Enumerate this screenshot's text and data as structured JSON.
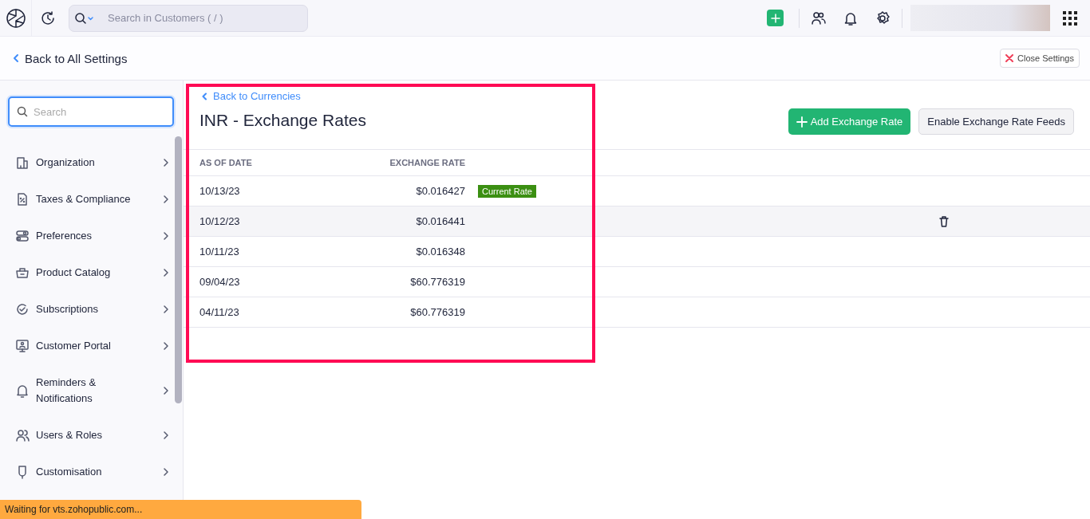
{
  "topbar": {
    "search": {
      "placeholder": "Search in Customers ( / )"
    }
  },
  "header": {
    "back_link": "Back to All Settings",
    "close_button": "Close Settings"
  },
  "sidebar": {
    "search": {
      "placeholder": "Search"
    },
    "items": [
      {
        "label": "Organization"
      },
      {
        "label": "Taxes & Compliance"
      },
      {
        "label": "Preferences"
      },
      {
        "label": "Product Catalog"
      },
      {
        "label": "Subscriptions"
      },
      {
        "label": "Customer Portal"
      },
      {
        "label": "Reminders & Notifications"
      },
      {
        "label": "Users & Roles"
      },
      {
        "label": "Customisation"
      }
    ]
  },
  "content": {
    "back_link": "Back to Currencies",
    "title": "INR - Exchange Rates",
    "buttons": [
      {
        "label": "Add Exchange Rate",
        "kind": "primary"
      },
      {
        "label": "Enable Exchange Rate Feeds",
        "kind": "secondary"
      }
    ],
    "table": {
      "columns": [
        "AS OF DATE",
        "EXCHANGE RATE"
      ],
      "rows": [
        {
          "date": "10/13/23",
          "rate": "$0.016427",
          "badge": "Current Rate",
          "hovered": false
        },
        {
          "date": "10/12/23",
          "rate": "$0.016441",
          "hovered": true
        },
        {
          "date": "10/11/23",
          "rate": "$0.016348",
          "hovered": false
        },
        {
          "date": "09/04/23",
          "rate": "$60.776319",
          "hovered": false
        },
        {
          "date": "04/11/23",
          "rate": "$60.776319",
          "hovered": false
        }
      ]
    }
  },
  "status_bar": "Waiting for vts.zohopublic.com..."
}
